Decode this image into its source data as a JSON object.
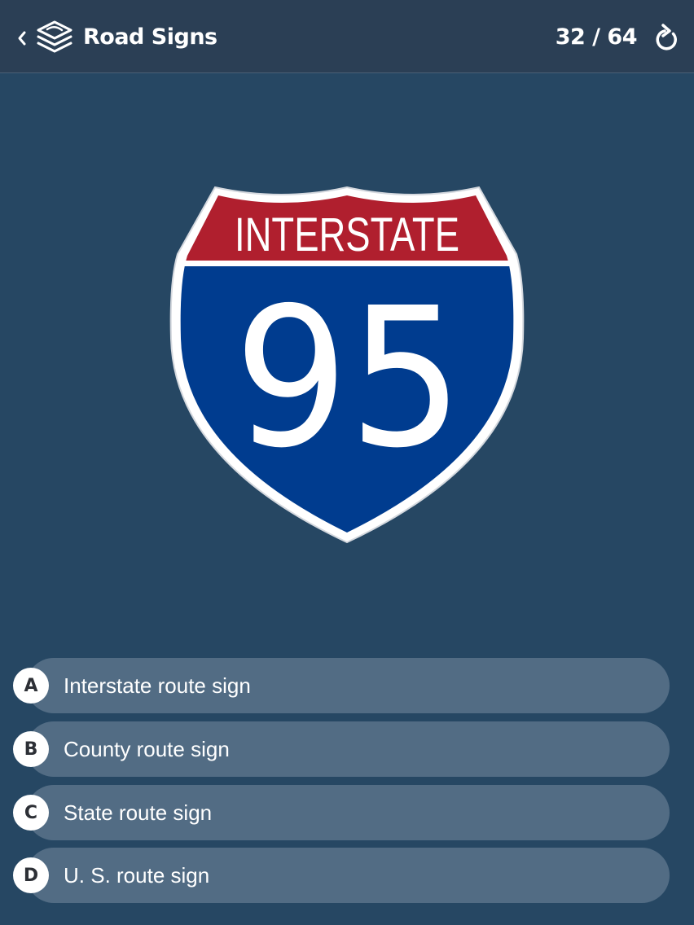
{
  "header": {
    "back_icon": "chevron-left-icon",
    "deck_icon": "stacked-layers-icon",
    "title": "Road Signs",
    "progress": "32 / 64",
    "refresh_icon": "refresh-icon"
  },
  "sign": {
    "type": "interstate-shield",
    "top_text": "INTERSTATE",
    "number": "95",
    "colors": {
      "red": "#b01f2e",
      "blue": "#003c8f",
      "white": "#ffffff"
    }
  },
  "options": [
    {
      "letter": "A",
      "text": "Interstate route sign"
    },
    {
      "letter": "B",
      "text": "County route sign"
    },
    {
      "letter": "C",
      "text": "State route sign"
    },
    {
      "letter": "D",
      "text": "U. S. route sign"
    }
  ],
  "colors": {
    "background": "#264763",
    "header": "#2b3f55",
    "option_bg": "#526c84"
  }
}
